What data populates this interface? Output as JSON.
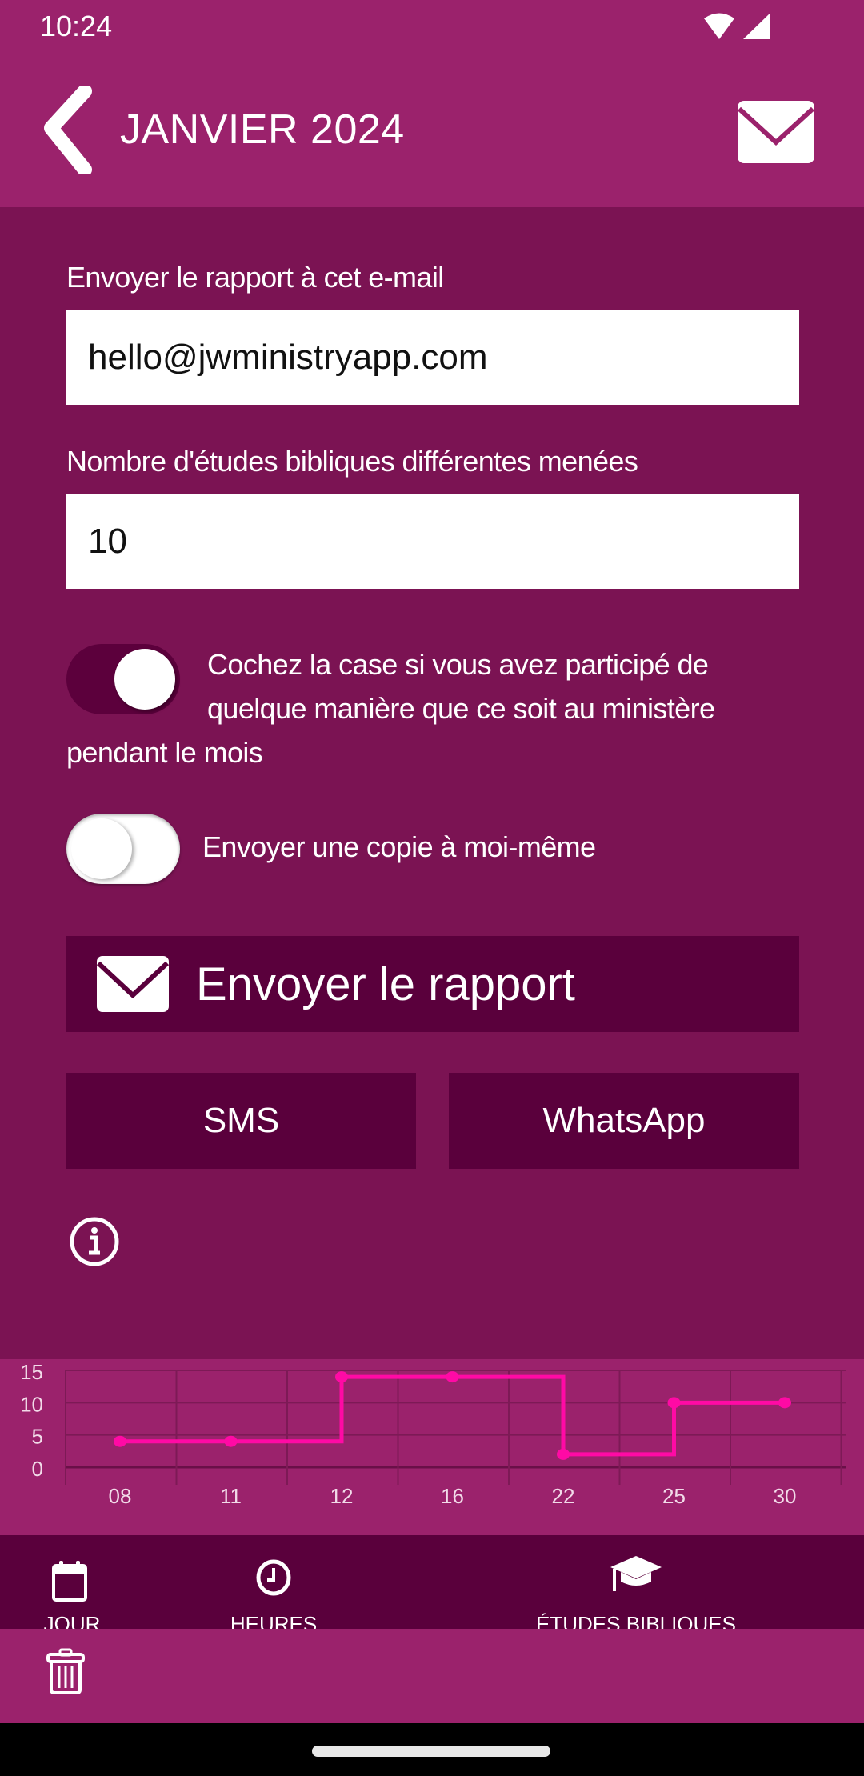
{
  "status_bar": {
    "time": "10:24",
    "icons": [
      "wifi-icon",
      "signal-icon"
    ]
  },
  "app_bar": {
    "title": "JANVIER 2024",
    "back_icon": "chevron-left-icon",
    "action_icon": "envelope-icon"
  },
  "form": {
    "email_label": "Envoyer le rapport à cet e-mail",
    "email_value": "hello@jwministryapp.com",
    "studies_label": "Nombre d'études bibliques différentes menées",
    "studies_value": "10",
    "participated_toggle": {
      "checked": true,
      "line1": "Cochez la case si vous avez participé de",
      "line2": "quelque manière que ce soit au ministère",
      "line3": "pendant le mois"
    },
    "copy_toggle": {
      "checked": false,
      "label": "Envoyer une copie à moi-même"
    }
  },
  "actions": {
    "send_report": "Envoyer le rapport",
    "sms": "SMS",
    "whatsapp": "WhatsApp",
    "info_icon": "info-icon"
  },
  "colors": {
    "primary": "#9b226c",
    "background": "#7b1353",
    "button": "#5a003c",
    "chart_line": "#ff0aa5"
  },
  "chart_data": {
    "type": "line",
    "step": true,
    "categories": [
      "08",
      "11",
      "12",
      "16",
      "22",
      "25",
      "30"
    ],
    "values": [
      4,
      4,
      14,
      14,
      2,
      10,
      10
    ],
    "y_ticks": [
      "0",
      "5",
      "10",
      "15"
    ],
    "ylim": [
      0,
      15
    ],
    "grid": true,
    "title": "",
    "xlabel": "",
    "ylabel": ""
  },
  "bottom_nav": {
    "items": [
      {
        "label": "JOUR",
        "icon": "calendar-icon"
      },
      {
        "label": "HEURES",
        "icon": "clock-icon"
      },
      {
        "label": "ÉTUDES BIBLIQUES",
        "icon": "graduation-cap-icon"
      }
    ]
  },
  "toolbar": {
    "delete_icon": "trash-icon"
  }
}
